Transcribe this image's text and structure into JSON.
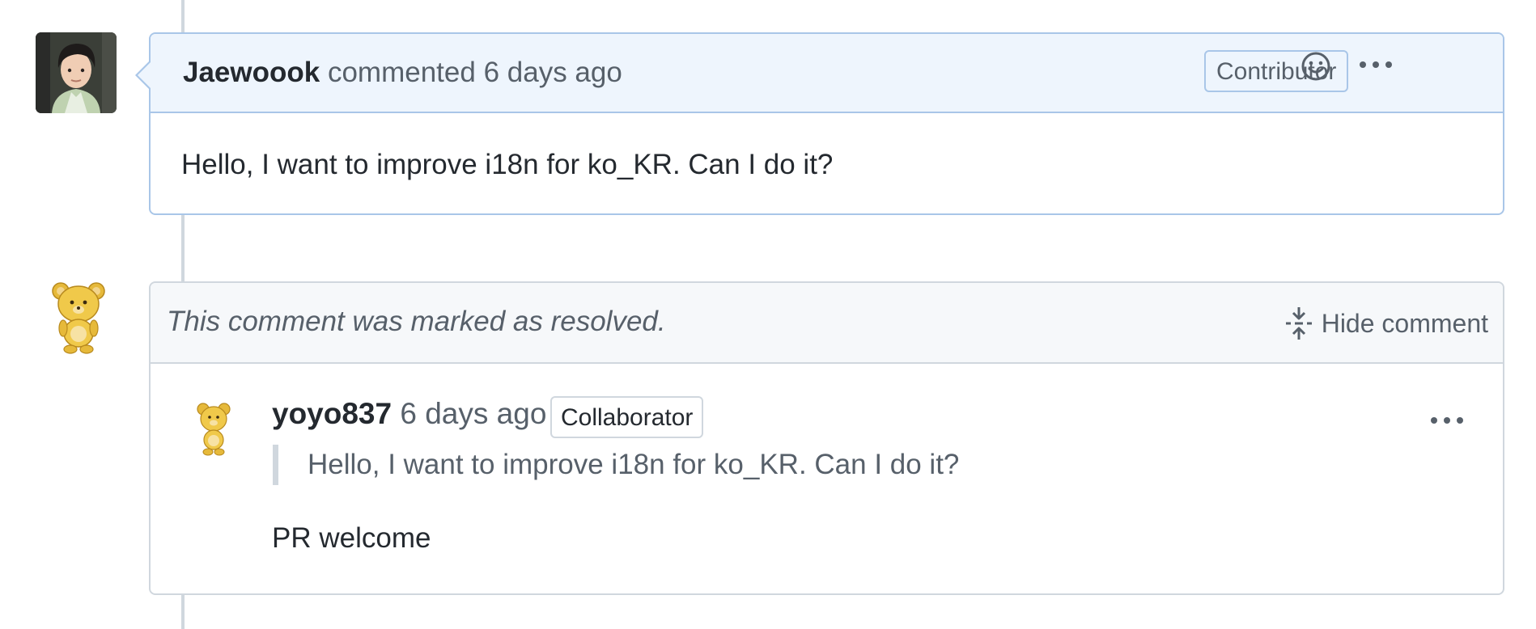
{
  "comment1": {
    "author": "Jaewoook",
    "action": "commented",
    "time": "6 days ago",
    "badge": "Contributor",
    "body": "Hello, I want to improve i18n for ko_KR. Can I do it?",
    "icons": {
      "reaction": "smiley-icon",
      "menu": "kebab-horizontal-icon"
    }
  },
  "comment2": {
    "resolved_text": "This comment was marked as resolved.",
    "hide_label": "Hide comment",
    "reply": {
      "author": "yoyo837",
      "time": "6 days ago",
      "badge": "Collaborator",
      "quote": "Hello, I want to improve i18n for ko_KR. Can I do it?",
      "body": "PR welcome"
    }
  },
  "colors": {
    "header_blue": "#eef5fd",
    "border_blue": "#a9c6e8",
    "muted_text": "#57606a",
    "border_gray": "#d0d7de"
  }
}
